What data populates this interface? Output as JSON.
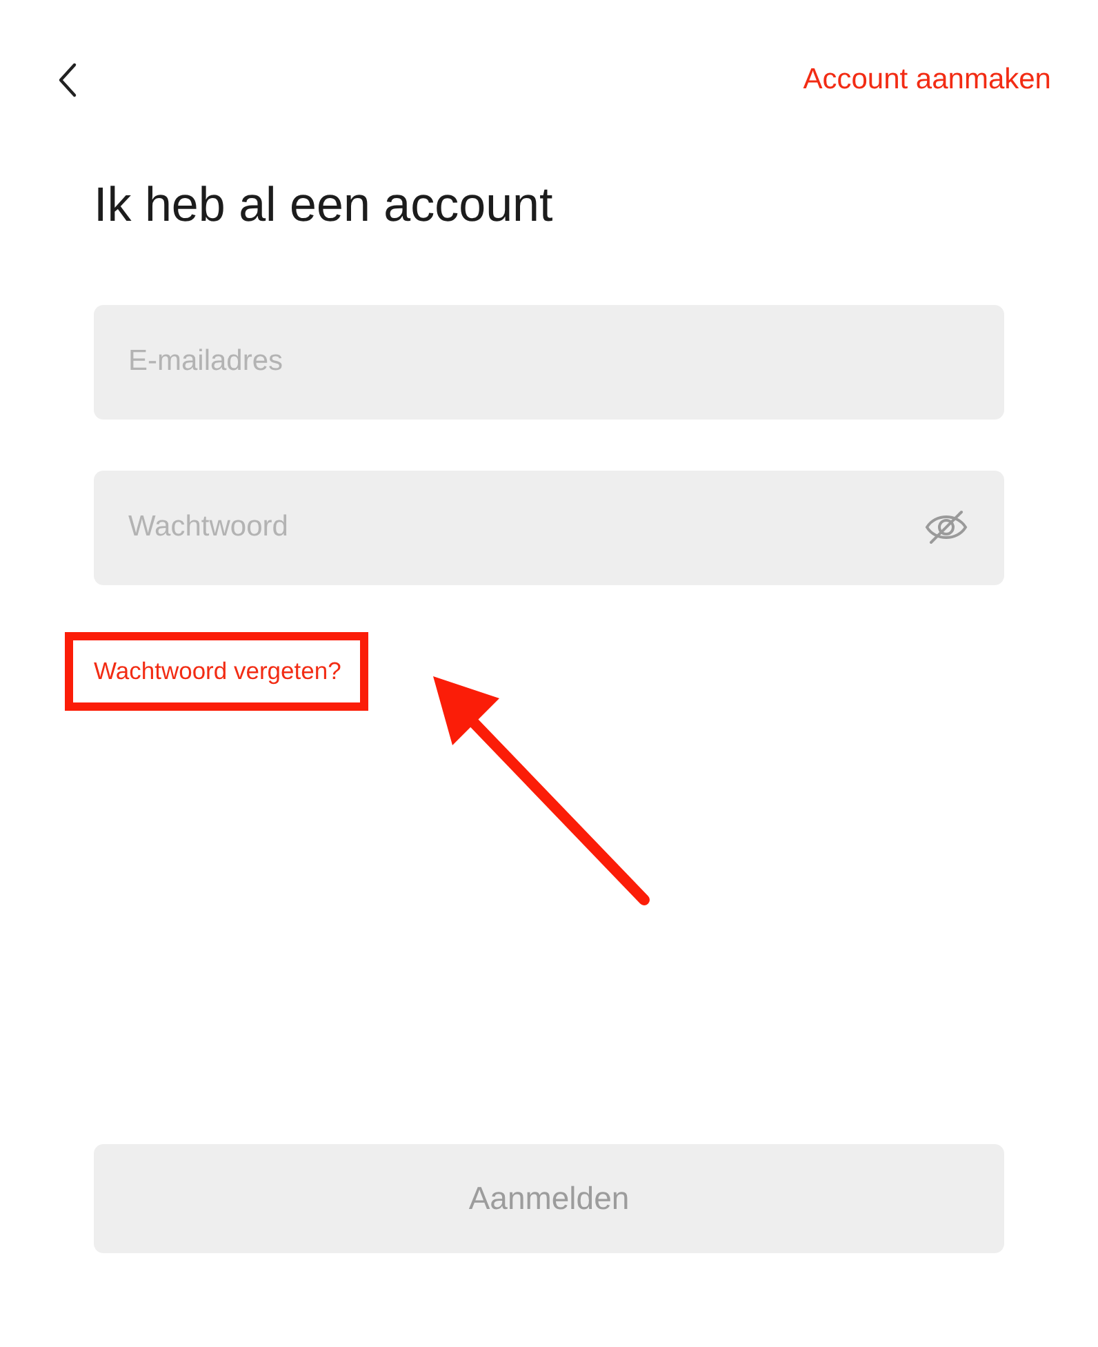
{
  "header": {
    "create_account_link": "Account aanmaken"
  },
  "title": "Ik heb al een account",
  "fields": [
    {
      "kind": "email",
      "placeholder": "E-mailadres"
    },
    {
      "kind": "password",
      "placeholder": "Wachtwoord"
    }
  ],
  "forgot_password_link": {
    "text": "Wachtwoord vergeten?",
    "highlighted": true
  },
  "annotation": {
    "kind": "arrow"
  },
  "submit_button": {
    "label": "Aanmelden",
    "disabled": true
  }
}
